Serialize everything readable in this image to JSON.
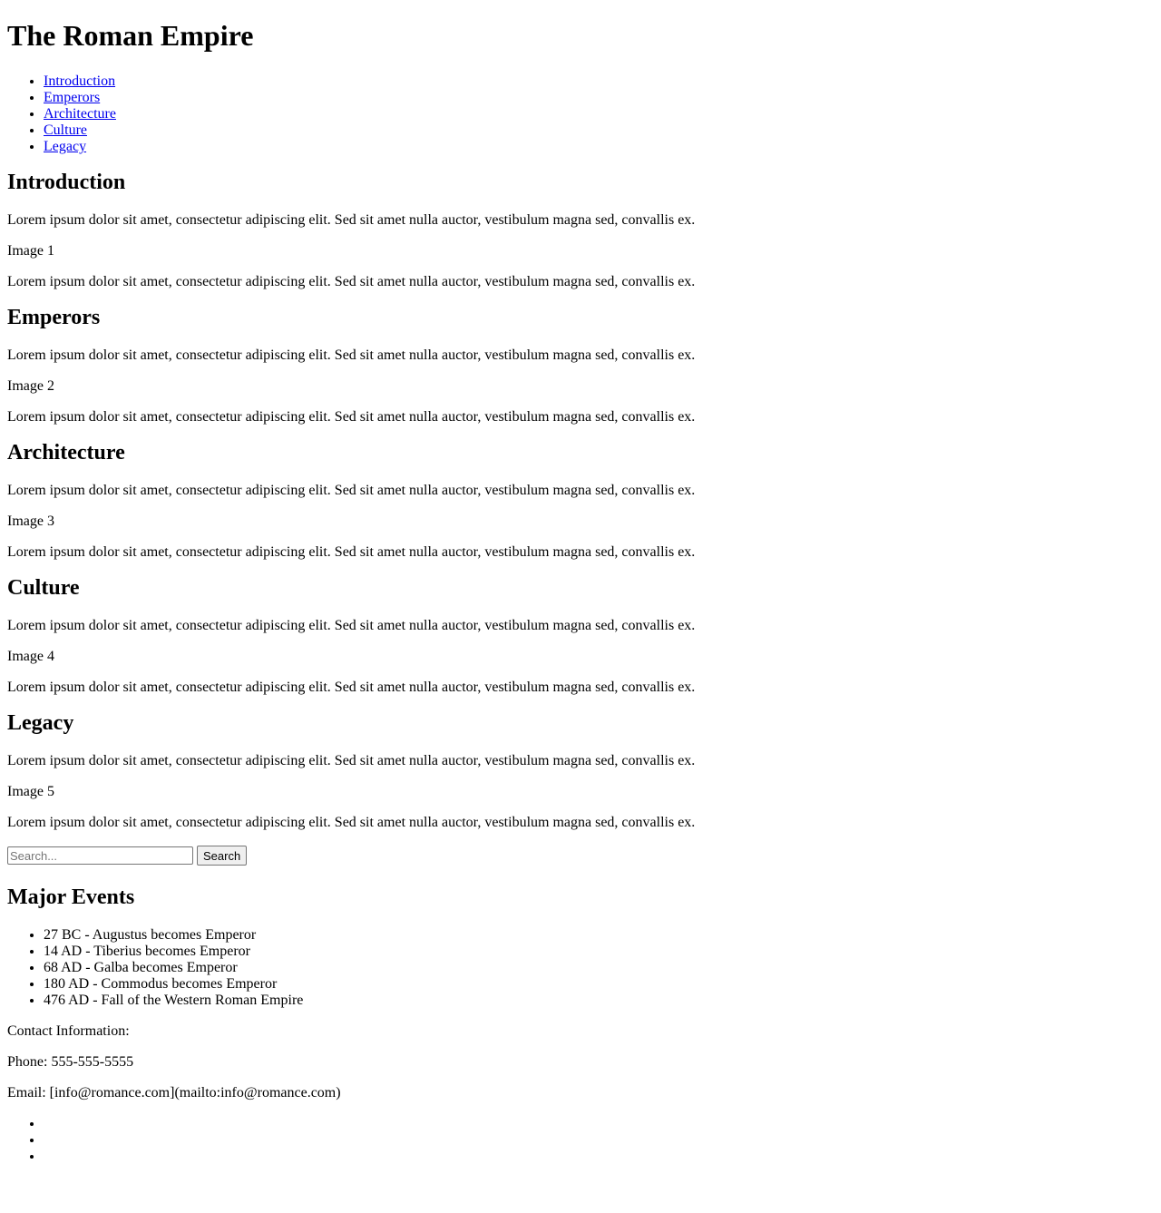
{
  "header": {
    "title": "The Roman Empire"
  },
  "nav": {
    "items": [
      {
        "label": "Introduction"
      },
      {
        "label": "Emperors"
      },
      {
        "label": "Architecture"
      },
      {
        "label": "Culture"
      },
      {
        "label": "Legacy"
      }
    ]
  },
  "sections": [
    {
      "heading": "Introduction",
      "para1": "Lorem ipsum dolor sit amet, consectetur adipiscing elit. Sed sit amet nulla auctor, vestibulum magna sed, convallis ex.",
      "image_alt": "Image 1",
      "para2": "Lorem ipsum dolor sit amet, consectetur adipiscing elit. Sed sit amet nulla auctor, vestibulum magna sed, convallis ex."
    },
    {
      "heading": "Emperors",
      "para1": "Lorem ipsum dolor sit amet, consectetur adipiscing elit. Sed sit amet nulla auctor, vestibulum magna sed, convallis ex.",
      "image_alt": "Image 2",
      "para2": "Lorem ipsum dolor sit amet, consectetur adipiscing elit. Sed sit amet nulla auctor, vestibulum magna sed, convallis ex."
    },
    {
      "heading": "Architecture",
      "para1": "Lorem ipsum dolor sit amet, consectetur adipiscing elit. Sed sit amet nulla auctor, vestibulum magna sed, convallis ex.",
      "image_alt": "Image 3",
      "para2": "Lorem ipsum dolor sit amet, consectetur adipiscing elit. Sed sit amet nulla auctor, vestibulum magna sed, convallis ex."
    },
    {
      "heading": "Culture",
      "para1": "Lorem ipsum dolor sit amet, consectetur adipiscing elit. Sed sit amet nulla auctor, vestibulum magna sed, convallis ex.",
      "image_alt": "Image 4",
      "para2": "Lorem ipsum dolor sit amet, consectetur adipiscing elit. Sed sit amet nulla auctor, vestibulum magna sed, convallis ex."
    },
    {
      "heading": "Legacy",
      "para1": "Lorem ipsum dolor sit amet, consectetur adipiscing elit. Sed sit amet nulla auctor, vestibulum magna sed, convallis ex.",
      "image_alt": "Image 5",
      "para2": "Lorem ipsum dolor sit amet, consectetur adipiscing elit. Sed sit amet nulla auctor, vestibulum magna sed, convallis ex."
    }
  ],
  "search": {
    "placeholder": "Search...",
    "value": "",
    "button_label": "Search"
  },
  "events": {
    "heading": "Major Events",
    "items": [
      "27 BC - Augustus becomes Emperor",
      "14 AD - Tiberius becomes Emperor",
      "68 AD - Galba becomes Emperor",
      "180 AD - Commodus becomes Emperor",
      "476 AD - Fall of the Western Roman Empire"
    ]
  },
  "contact": {
    "heading": "Contact Information:",
    "phone": "Phone: 555-555-5555",
    "email": "Email: [info@romance.com](mailto:info@romance.com)"
  },
  "colors": {
    "link": "#0000ee",
    "text": "#000000",
    "background": "#ffffff"
  }
}
